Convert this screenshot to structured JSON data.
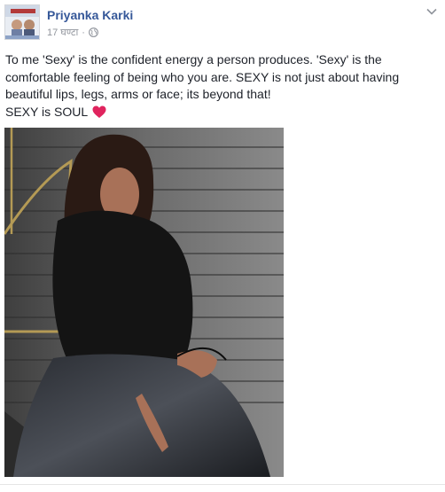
{
  "post": {
    "author": "Priyanka Karki",
    "timestamp": "17 घण्टा",
    "separator": "·",
    "privacy_icon": "globe-icon",
    "menu_icon": "chevron-down-icon",
    "text_lines": [
      "To me 'Sexy' is the confident energy a person produces. 'Sexy' is the comfortable feeling of being who you are. SEXY is not just about having beautiful lips, legs, arms or face; its beyond that!",
      "SEXY is SOUL"
    ],
    "emoji": "heart-emoji",
    "emoji_color": "#e0245e",
    "link_color": "#365899",
    "meta_color": "#90949c"
  }
}
